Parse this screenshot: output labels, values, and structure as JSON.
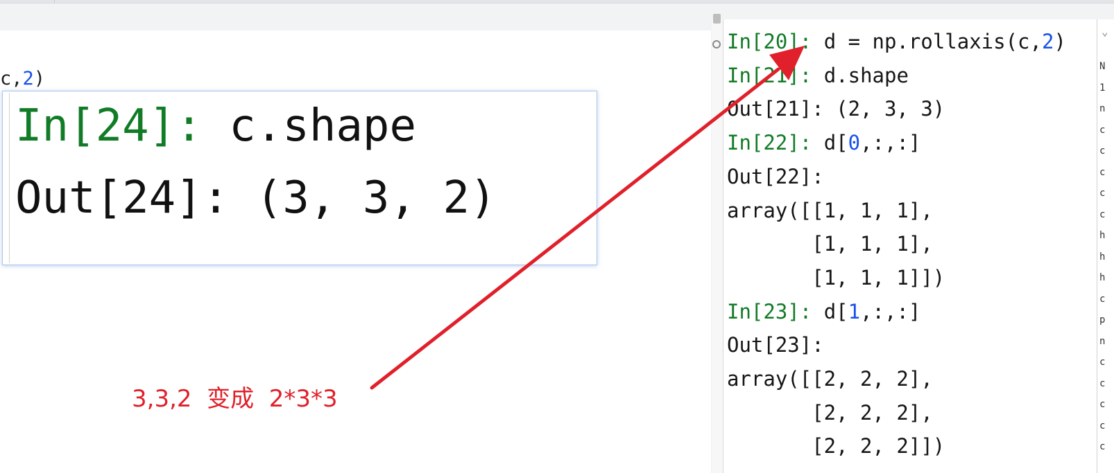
{
  "partial_code": {
    "prefix": "c,",
    "number": "2",
    "suffix": ")"
  },
  "zoom": {
    "line1_prompt": "In[24]: ",
    "line1_code": "c.shape",
    "line2": "Out[24]: (3, 3, 2)"
  },
  "annotation": {
    "text": "3,3,2  变成  2*3*3",
    "color": "#e0202a"
  },
  "console": {
    "lines": [
      {
        "prompt": "In[20]: ",
        "pre": "d = np.rollaxis(c,",
        "num": "2",
        "post": ")"
      },
      {
        "prompt": "In[21]: ",
        "pre": "d.shape",
        "num": "",
        "post": ""
      },
      {
        "prompt": "",
        "pre": "Out[21]: (2, 3, 3)",
        "num": "",
        "post": ""
      },
      {
        "prompt": "In[22]: ",
        "pre": "d[",
        "num": "0",
        "post": ",:,:]"
      },
      {
        "prompt": "",
        "pre": "Out[22]:",
        "num": "",
        "post": ""
      },
      {
        "prompt": "",
        "pre": "array([[1, 1, 1],",
        "num": "",
        "post": ""
      },
      {
        "prompt": "",
        "pre": "       [1, 1, 1],",
        "num": "",
        "post": ""
      },
      {
        "prompt": "",
        "pre": "       [1, 1, 1]])",
        "num": "",
        "post": ""
      },
      {
        "prompt": "In[23]: ",
        "pre": "d[",
        "num": "1",
        "post": ",:,:]"
      },
      {
        "prompt": "",
        "pre": "Out[23]:",
        "num": "",
        "post": ""
      },
      {
        "prompt": "",
        "pre": "array([[2, 2, 2],",
        "num": "",
        "post": ""
      },
      {
        "prompt": "",
        "pre": "       [2, 2, 2],",
        "num": "",
        "post": ""
      },
      {
        "prompt": "",
        "pre": "       [2, 2, 2]])",
        "num": "",
        "post": ""
      }
    ]
  },
  "right_strip": {
    "chars": [
      "N",
      "1",
      "n",
      "c",
      "c",
      "c",
      "c",
      "c",
      "h",
      "h",
      "h",
      "c",
      "p",
      "n",
      "c",
      "c",
      "c",
      "c",
      "c"
    ]
  },
  "colors": {
    "prompt": "#117b26",
    "number": "#1750eb",
    "arrow": "#e0202a"
  },
  "icons": {
    "gutter_top": "fold-marker-icon",
    "gutter_clock": "history-clock-icon",
    "strip_caret": "chevron-down-icon",
    "arrow": "red-annotation-arrow"
  }
}
